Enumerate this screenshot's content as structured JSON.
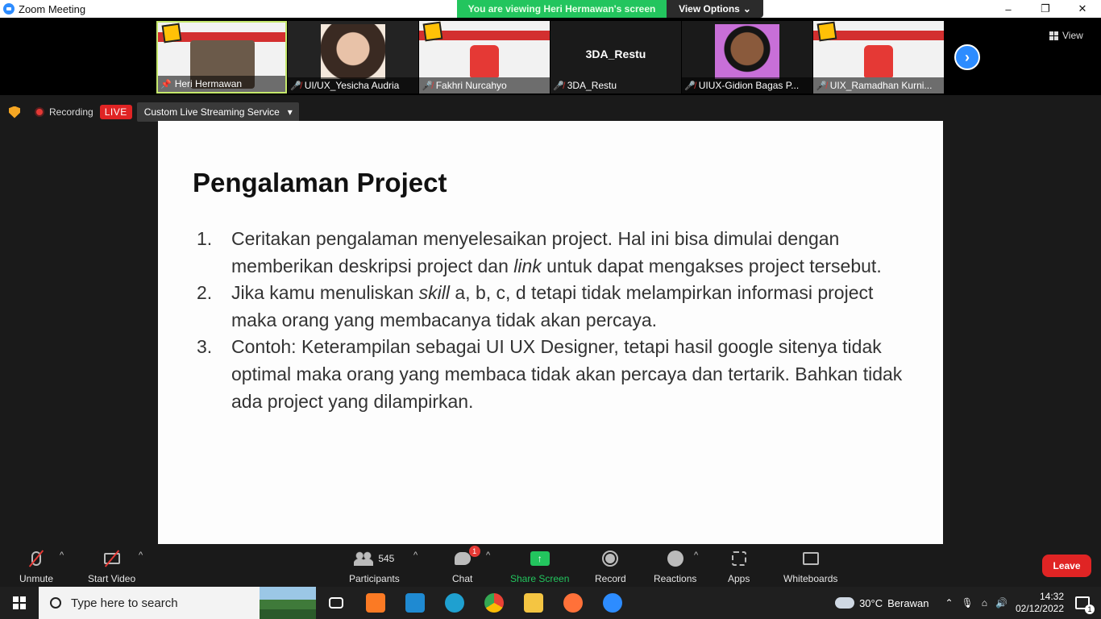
{
  "window": {
    "title": "Zoom Meeting",
    "viewing_banner": "You are viewing Heri Hermawan's screen",
    "view_options_label": "View Options",
    "controls": [
      "–",
      "❐",
      "✕"
    ]
  },
  "gallery": {
    "participants": [
      {
        "name": "Heri Hermawan",
        "type": "slide-speaker",
        "muted": false,
        "pinned": true
      },
      {
        "name": "UI/UX_Yesicha Audria",
        "type": "photo-hijab",
        "muted": true
      },
      {
        "name": "Fakhri Nurcahyo",
        "type": "slide",
        "muted": true
      },
      {
        "name": "3DA_Restu",
        "type": "name-only",
        "muted": true
      },
      {
        "name": "UIUX-Gidion Bagas P...",
        "type": "photo-boy",
        "muted": true
      },
      {
        "name": "UIX_Ramadhan Kurni...",
        "type": "slide",
        "muted": true
      }
    ],
    "center_name": "3DA_Restu",
    "view_label": "View"
  },
  "recording": {
    "label": "Recording",
    "live_badge": "LIVE",
    "stream_service": "Custom Live Streaming Service"
  },
  "slide": {
    "title": "Pengalaman Project",
    "items": [
      {
        "num": "1.",
        "text_before": "Ceritakan pengalaman menyelesaikan project. Hal ini bisa dimulai dengan memberikan deskripsi project dan ",
        "italic": "link",
        "text_after": " untuk dapat mengakses project tersebut."
      },
      {
        "num": "2.",
        "text_before": "Jika kamu menuliskan ",
        "italic": "skill",
        "text_after": " a, b, c, d tetapi tidak melampirkan informasi project maka orang yang membacanya tidak akan percaya."
      },
      {
        "num": "3.",
        "text_before": "Contoh: Keterampilan sebagai UI UX Designer, tetapi hasil google sitenya tidak optimal maka orang yang membaca tidak akan percaya dan tertarik. Bahkan tidak ada project yang dilampirkan.",
        "italic": "",
        "text_after": ""
      }
    ]
  },
  "toolbar": {
    "unmute": "Unmute",
    "start_video": "Start Video",
    "participants": "Participants",
    "participant_count": "545",
    "chat": "Chat",
    "chat_badge": "1",
    "share_screen": "Share Screen",
    "record": "Record",
    "reactions": "Reactions",
    "apps": "Apps",
    "whiteboards": "Whiteboards",
    "leave": "Leave"
  },
  "taskbar": {
    "search_placeholder": "Type here to search",
    "weather_temp": "30°C",
    "weather_desc": "Berawan",
    "time": "14:32",
    "date": "02/12/2022",
    "notifications": "1",
    "apps": [
      {
        "name": "task-view",
        "color": "#2b2b2b"
      },
      {
        "name": "xampp",
        "color": "#fb7a24"
      },
      {
        "name": "vscode",
        "color": "#1f8ad2"
      },
      {
        "name": "edge",
        "color": "#1fa0d0"
      },
      {
        "name": "chrome",
        "color": "#e94235"
      },
      {
        "name": "file-explorer",
        "color": "#f4c542"
      },
      {
        "name": "firefox",
        "color": "#ff7139"
      },
      {
        "name": "zoom",
        "color": "#2d8cff"
      }
    ]
  }
}
